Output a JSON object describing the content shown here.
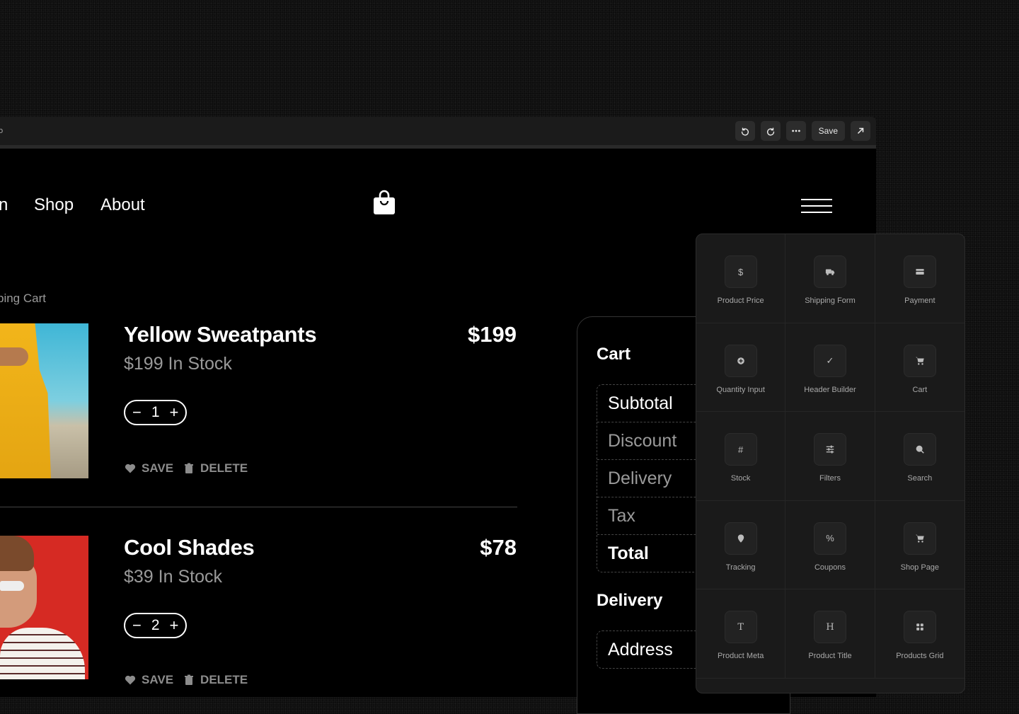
{
  "toolbar": {
    "left_fragment": "o",
    "save_label": "Save",
    "icons": [
      "undo-icon",
      "redo-icon",
      "more-icon",
      "external-link-icon"
    ]
  },
  "site_nav": {
    "partial_link": "n",
    "links": [
      "Shop",
      "About"
    ],
    "cart_icon": "shopping-bag-icon",
    "menu_icon": "hamburger-menu-icon"
  },
  "breadcrumb": "ping Cart",
  "items": [
    {
      "title": "Yellow Sweatpants",
      "subtitle": "$199 In Stock",
      "price": "$199",
      "quantity": "1",
      "save_label": "SAVE",
      "delete_label": "DELETE"
    },
    {
      "title": "Cool Shades",
      "subtitle": "$39 In Stock",
      "price": "$78",
      "quantity": "2",
      "save_label": "SAVE",
      "delete_label": "DELETE"
    }
  ],
  "stepper": {
    "minus": "−",
    "plus": "+"
  },
  "summary": {
    "cart_heading": "Cart",
    "rows": [
      "Subtotal",
      "Discount",
      "Delivery",
      "Tax",
      "Total"
    ],
    "delivery_heading": "Delivery",
    "delivery_rows": [
      "Address"
    ]
  },
  "palette": {
    "widgets": [
      {
        "label": "Product Price",
        "icon": "dollar-icon",
        "glyph": "$"
      },
      {
        "label": "Shipping Form",
        "icon": "truck-icon",
        "glyph": ""
      },
      {
        "label": "Payment",
        "icon": "credit-card-icon",
        "glyph": ""
      },
      {
        "label": "Quantity Input",
        "icon": "plus-circle-icon",
        "glyph": ""
      },
      {
        "label": "Header Builder",
        "icon": "check-icon",
        "glyph": "✓"
      },
      {
        "label": "Cart",
        "icon": "cart-icon",
        "glyph": ""
      },
      {
        "label": "Stock",
        "icon": "hash-icon",
        "glyph": "#"
      },
      {
        "label": "Filters",
        "icon": "sliders-icon",
        "glyph": ""
      },
      {
        "label": "Search",
        "icon": "search-icon",
        "glyph": ""
      },
      {
        "label": "Tracking",
        "icon": "map-pin-icon",
        "glyph": ""
      },
      {
        "label": "Coupons",
        "icon": "percent-icon",
        "glyph": "%"
      },
      {
        "label": "Shop Page",
        "icon": "cart-icon",
        "glyph": ""
      },
      {
        "label": "Product Meta",
        "icon": "text-icon",
        "glyph": "T"
      },
      {
        "label": "Product Title",
        "icon": "heading-icon",
        "glyph": "H"
      },
      {
        "label": "Products Grid",
        "icon": "grid-icon",
        "glyph": ""
      }
    ]
  }
}
